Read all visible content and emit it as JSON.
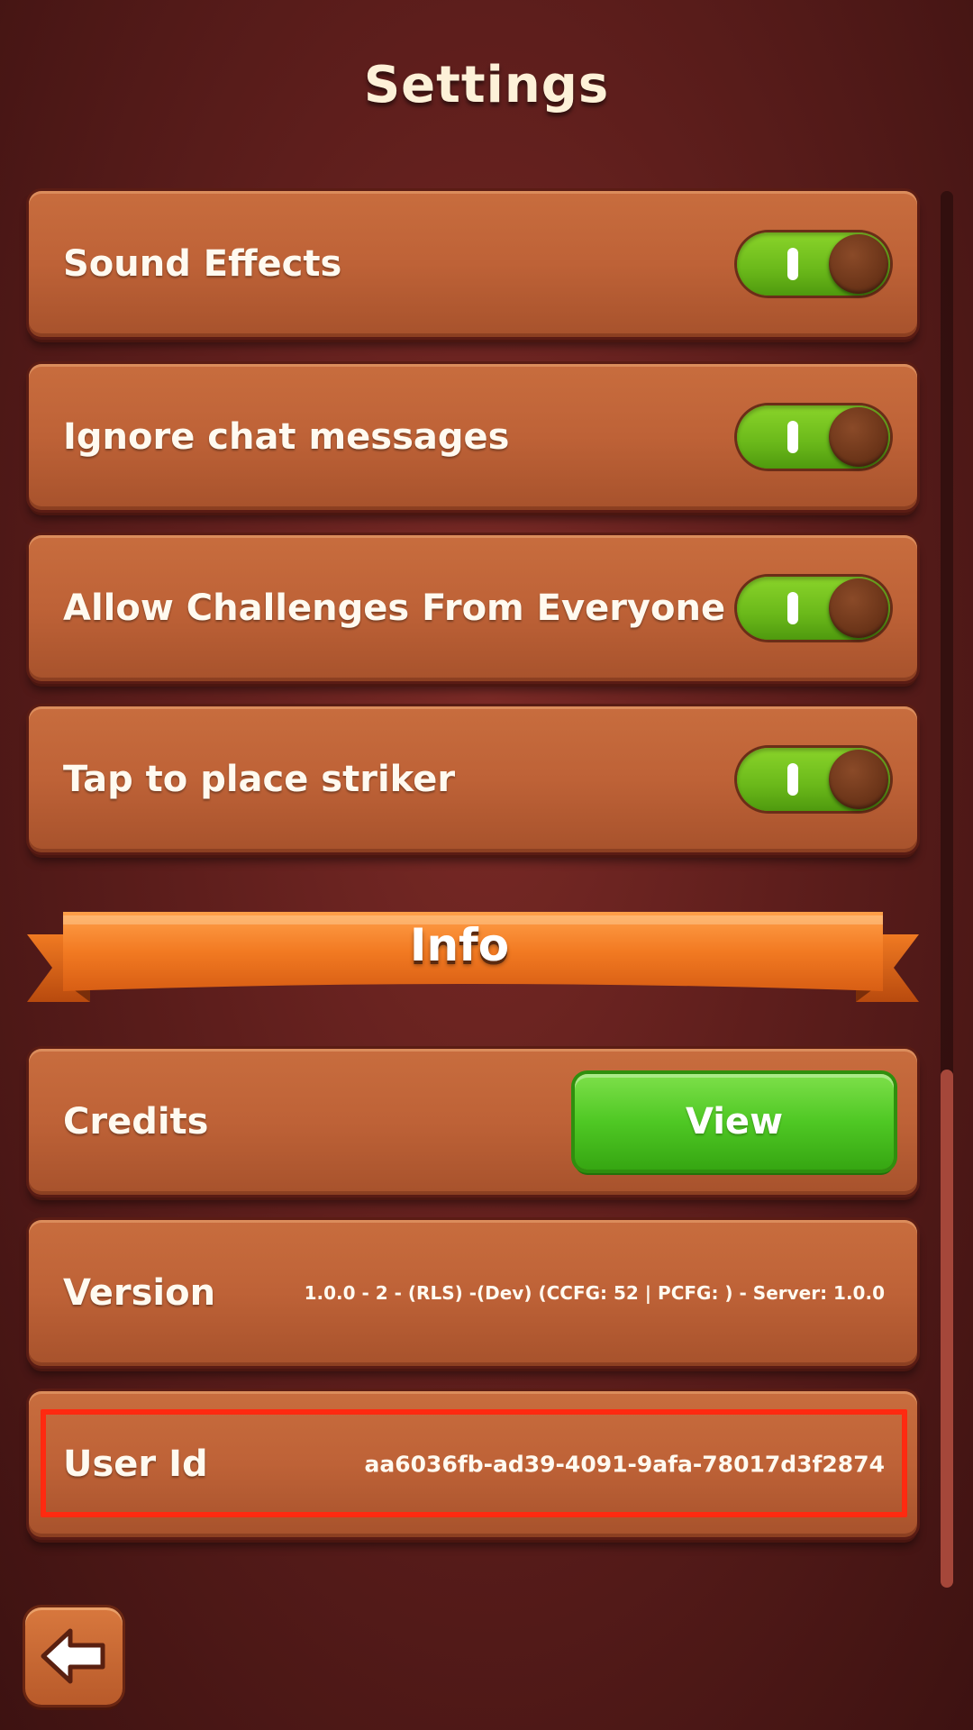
{
  "header": {
    "title": "Settings"
  },
  "settings": {
    "toggles": [
      {
        "label": "Sound Effects",
        "enabled": true
      },
      {
        "label": "Ignore chat messages",
        "enabled": true
      },
      {
        "label": "Allow Challenges From Everyone",
        "enabled": true
      },
      {
        "label": "Tap to place striker",
        "enabled": true
      }
    ]
  },
  "info": {
    "section_title": "Info",
    "credits": {
      "label": "Credits",
      "button_label": "View"
    },
    "version": {
      "label": "Version",
      "value": "1.0.0 - 2 - (RLS) -(Dev) (CCFG: 52 | PCFG: ) - Server: 1.0.0"
    },
    "user_id": {
      "label": "User Id",
      "value": "aa6036fb-ad39-4091-9afa-78017d3f2874"
    }
  },
  "icons": {
    "back": "arrow-left-icon"
  },
  "colors": {
    "card": "#c0643a",
    "toggle_on": "#6ab81a",
    "view_button": "#4fc824",
    "ribbon": "#f07a22",
    "highlight": "#ff2a10"
  }
}
